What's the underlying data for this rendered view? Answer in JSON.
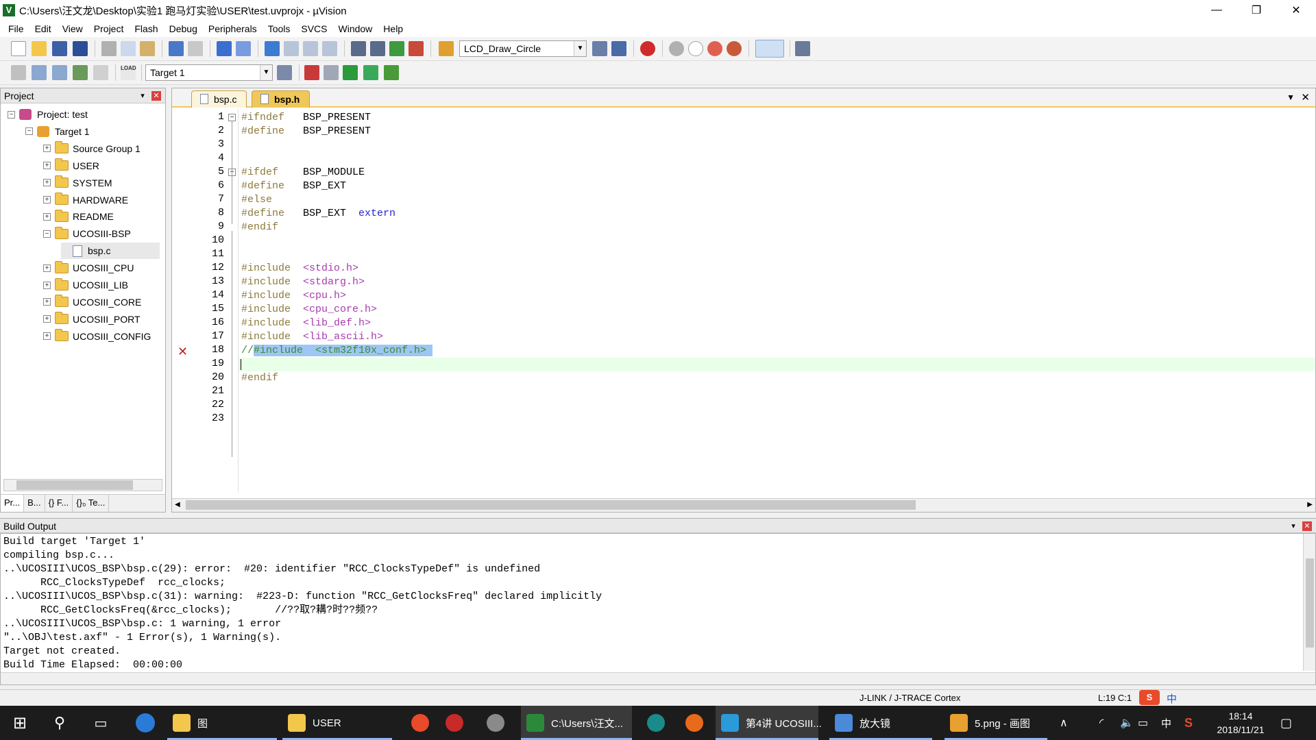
{
  "window": {
    "title": "C:\\Users\\汪文龙\\Desktop\\实验1 跑马灯实验\\USER\\test.uvprojx - µVision",
    "minimize": "—",
    "restore": "❐",
    "close": "✕"
  },
  "menu": [
    "File",
    "Edit",
    "View",
    "Project",
    "Flash",
    "Debug",
    "Peripherals",
    "Tools",
    "SVCS",
    "Window",
    "Help"
  ],
  "toolbar": {
    "function_combo": "LCD_Draw_Circle",
    "target_combo": "Target 1",
    "load_label": "LOAD"
  },
  "project_panel": {
    "title": "Project",
    "pin": "📌",
    "close": "✕",
    "tree": [
      {
        "label": "Project: test",
        "indent": 0,
        "expander": "−",
        "kind": "project"
      },
      {
        "label": "Target 1",
        "indent": 1,
        "expander": "−",
        "kind": "target"
      },
      {
        "label": "Source Group 1",
        "indent": 2,
        "expander": "+",
        "kind": "folder"
      },
      {
        "label": "USER",
        "indent": 2,
        "expander": "+",
        "kind": "folder"
      },
      {
        "label": "SYSTEM",
        "indent": 2,
        "expander": "+",
        "kind": "folder"
      },
      {
        "label": "HARDWARE",
        "indent": 2,
        "expander": "+",
        "kind": "folder"
      },
      {
        "label": "README",
        "indent": 2,
        "expander": "+",
        "kind": "folder"
      },
      {
        "label": "UCOSIII-BSP",
        "indent": 2,
        "expander": "−",
        "kind": "folder"
      },
      {
        "label": "bsp.c",
        "indent": 3,
        "expander": "",
        "kind": "file"
      },
      {
        "label": "UCOSIII_CPU",
        "indent": 2,
        "expander": "+",
        "kind": "folder"
      },
      {
        "label": "UCOSIII_LIB",
        "indent": 2,
        "expander": "+",
        "kind": "folder"
      },
      {
        "label": "UCOSIII_CORE",
        "indent": 2,
        "expander": "+",
        "kind": "folder"
      },
      {
        "label": "UCOSIII_PORT",
        "indent": 2,
        "expander": "+",
        "kind": "folder"
      },
      {
        "label": "UCOSIII_CONFIG",
        "indent": 2,
        "expander": "+",
        "kind": "folder"
      }
    ],
    "tabs": [
      "Pr...",
      "B...",
      "{} F...",
      "{}₀ Te..."
    ]
  },
  "editor": {
    "tabs": [
      {
        "label": "bsp.c",
        "active": false
      },
      {
        "label": "bsp.h",
        "active": true
      }
    ],
    "lines": [
      {
        "n": "1",
        "parts": [
          [
            "pp",
            "#ifndef"
          ],
          [
            "",
            "   BSP_PRESENT"
          ]
        ]
      },
      {
        "n": "2",
        "parts": [
          [
            "pp",
            "#define"
          ],
          [
            "",
            "   BSP_PRESENT"
          ]
        ]
      },
      {
        "n": "3",
        "parts": []
      },
      {
        "n": "4",
        "parts": []
      },
      {
        "n": "5",
        "parts": [
          [
            "pp",
            "#ifdef"
          ],
          [
            "",
            "    BSP_MODULE"
          ]
        ]
      },
      {
        "n": "6",
        "parts": [
          [
            "pp",
            "#define"
          ],
          [
            "",
            "   BSP_EXT"
          ]
        ]
      },
      {
        "n": "7",
        "parts": [
          [
            "pp",
            "#else"
          ]
        ]
      },
      {
        "n": "8",
        "parts": [
          [
            "pp",
            "#define"
          ],
          [
            "",
            "   BSP_EXT  "
          ],
          [
            "kw",
            "extern"
          ]
        ]
      },
      {
        "n": "9",
        "parts": [
          [
            "pp",
            "#endif"
          ]
        ]
      },
      {
        "n": "10",
        "parts": []
      },
      {
        "n": "11",
        "parts": []
      },
      {
        "n": "12",
        "parts": [
          [
            "pp",
            "#include"
          ],
          [
            "",
            "  "
          ],
          [
            "inc",
            "<stdio.h>"
          ]
        ]
      },
      {
        "n": "13",
        "parts": [
          [
            "pp",
            "#include"
          ],
          [
            "",
            "  "
          ],
          [
            "inc",
            "<stdarg.h>"
          ]
        ]
      },
      {
        "n": "14",
        "parts": [
          [
            "pp",
            "#include"
          ],
          [
            "",
            "  "
          ],
          [
            "inc",
            "<cpu.h>"
          ]
        ]
      },
      {
        "n": "15",
        "parts": [
          [
            "pp",
            "#include"
          ],
          [
            "",
            "  "
          ],
          [
            "inc",
            "<cpu_core.h>"
          ]
        ]
      },
      {
        "n": "16",
        "parts": [
          [
            "pp",
            "#include"
          ],
          [
            "",
            "  "
          ],
          [
            "inc",
            "<lib_def.h>"
          ]
        ]
      },
      {
        "n": "17",
        "parts": [
          [
            "pp",
            "#include"
          ],
          [
            "",
            "  "
          ],
          [
            "inc",
            "<lib_ascii.h>"
          ]
        ]
      },
      {
        "n": "18",
        "parts": [
          [
            "cm",
            "//"
          ],
          [
            "cm sel",
            "#include  <stm32f10x_conf.h> "
          ]
        ]
      },
      {
        "n": "19",
        "parts": []
      },
      {
        "n": "20",
        "parts": [
          [
            "pp",
            "#endif"
          ]
        ]
      },
      {
        "n": "21",
        "parts": []
      },
      {
        "n": "22",
        "parts": []
      },
      {
        "n": "23",
        "parts": []
      }
    ]
  },
  "build_output": {
    "title": "Build Output",
    "lines": [
      "Build target 'Target 1'",
      "compiling bsp.c...",
      "..\\UCOSIII\\UCOS_BSP\\bsp.c(29): error:  #20: identifier \"RCC_ClocksTypeDef\" is undefined",
      "      RCC_ClocksTypeDef  rcc_clocks;",
      "..\\UCOSIII\\UCOS_BSP\\bsp.c(31): warning:  #223-D: function \"RCC_GetClocksFreq\" declared implicitly",
      "      RCC_GetClocksFreq(&rcc_clocks);       //??取?耩?时??频??",
      "..\\UCOSIII\\UCOS_BSP\\bsp.c: 1 warning, 1 error",
      "\"..\\OBJ\\test.axf\" - 1 Error(s), 1 Warning(s).",
      "Target not created.",
      "Build Time Elapsed:  00:00:00"
    ]
  },
  "status": {
    "debugger": "J-LINK / J-TRACE Cortex",
    "position": "L:19 C:1",
    "ime": "中"
  },
  "taskbar": {
    "items": [
      {
        "label": "图"
      },
      {
        "label": "USER"
      },
      {
        "label": "C:\\Users\\汪文..."
      },
      {
        "label": "第4讲 UCOSIII..."
      },
      {
        "label": "放大镜"
      },
      {
        "label": "5.png - 画图"
      }
    ],
    "tray_lang": "中",
    "time": "18:14",
    "date": "2018/11/21"
  },
  "colors": {
    "accent_tab": "#f0c85a",
    "selection": "#9ec6f3",
    "preprocessor": "#8b7a3a",
    "keyword": "#2424d8",
    "include_path": "#a63cad",
    "comment": "#3b8a3b"
  }
}
